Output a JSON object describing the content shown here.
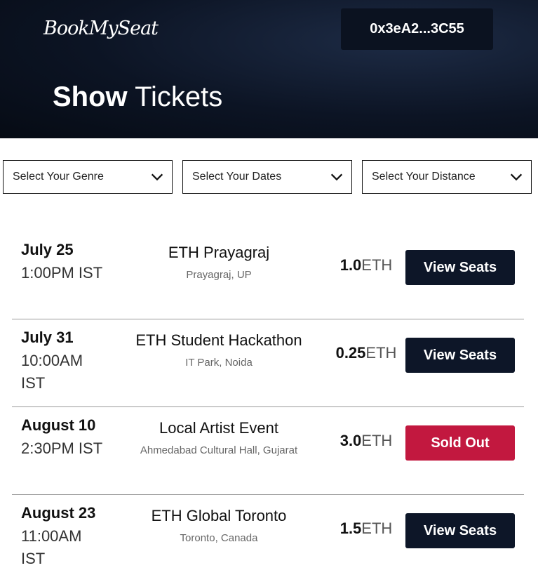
{
  "header": {
    "logo": "BookMySeat",
    "wallet_address": "0x3eA2...3C55",
    "title_bold": "Show",
    "title_light": "Tickets"
  },
  "filters": {
    "genre": "Select Your Genre",
    "dates": "Select Your Dates",
    "distance": "Select Your Distance"
  },
  "events": [
    {
      "day": "July 25",
      "time": "1:00PM IST",
      "name": "ETH Prayagraj",
      "venue": "Prayagraj, UP",
      "price": "1.0",
      "unit": "ETH",
      "button": "View Seats",
      "status": "available"
    },
    {
      "day": "July 31",
      "time": "10:00AM IST",
      "name": "ETH Student Hackathon",
      "venue": "IT Park, Noida",
      "price": "0.25",
      "unit": "ETH",
      "button": "View Seats",
      "status": "available"
    },
    {
      "day": "August 10",
      "time": "2:30PM IST",
      "name": "Local Artist Event",
      "venue": "Ahmedabad Cultural Hall, Gujarat",
      "price": "3.0",
      "unit": "ETH",
      "button": "Sold Out",
      "status": "sold"
    },
    {
      "day": "August 23",
      "time": "11:00AM IST",
      "name": "ETH Global Toronto",
      "venue": "Toronto, Canada",
      "price": "1.5",
      "unit": "ETH",
      "button": "View Seats",
      "status": "available"
    }
  ],
  "colors": {
    "accent_dark": "#0d1628",
    "sold_out": "#c2183f",
    "hero_bg": "#0c1424"
  }
}
